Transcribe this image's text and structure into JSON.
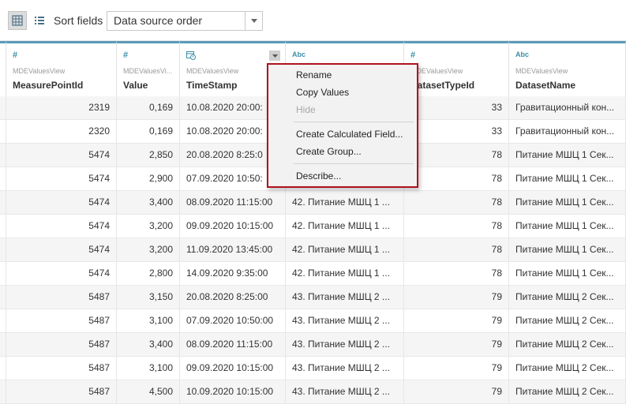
{
  "toolbar": {
    "sort_label": "Sort fields",
    "sort_value": "Data source order",
    "grid_icon": "grid-icon",
    "list_icon": "list-icon"
  },
  "columns": [
    {
      "type_icon": "#",
      "source": "",
      "name": ""
    },
    {
      "type_icon": "#",
      "source": "MDEValuesView",
      "name": "MeasurePointId"
    },
    {
      "type_icon": "#",
      "source": "MDEValuesVi...",
      "name": "Value"
    },
    {
      "type_icon": "calendar-clock",
      "source": "MDEValuesView",
      "name": "TimeStamp"
    },
    {
      "type_icon": "Abc",
      "source": "",
      "name": ""
    },
    {
      "type_icon": "#",
      "source": "MDEValuesView",
      "name": "DatasetTypeId"
    },
    {
      "type_icon": "Abc",
      "source": "MDEValuesView",
      "name": "DatasetName"
    }
  ],
  "rows": [
    {
      "mp": "2319",
      "val": "0,169",
      "ts": "10.08.2020 20:00:",
      "txt": "",
      "dt": "33",
      "dn": "Гравитационный кон..."
    },
    {
      "mp": "2320",
      "val": "0,169",
      "ts": "10.08.2020 20:00:",
      "txt": "",
      "dt": "33",
      "dn": "Гравитационный кон..."
    },
    {
      "mp": "5474",
      "val": "2,850",
      "ts": "20.08.2020 8:25:0",
      "txt": "",
      "dt": "78",
      "dn": "Питание МШЦ 1 Сек..."
    },
    {
      "mp": "5474",
      "val": "2,900",
      "ts": "07.09.2020 10:50:",
      "txt": "",
      "dt": "78",
      "dn": "Питание МШЦ 1 Сек..."
    },
    {
      "mp": "5474",
      "val": "3,400",
      "ts": "08.09.2020 11:15:00",
      "txt": "42. Питание МШЦ 1 ...",
      "dt": "78",
      "dn": "Питание МШЦ 1 Сек..."
    },
    {
      "mp": "5474",
      "val": "3,200",
      "ts": "09.09.2020 10:15:00",
      "txt": "42. Питание МШЦ 1 ...",
      "dt": "78",
      "dn": "Питание МШЦ 1 Сек..."
    },
    {
      "mp": "5474",
      "val": "3,200",
      "ts": "11.09.2020 13:45:00",
      "txt": "42. Питание МШЦ 1 ...",
      "dt": "78",
      "dn": "Питание МШЦ 1 Сек..."
    },
    {
      "mp": "5474",
      "val": "2,800",
      "ts": "14.09.2020 9:35:00",
      "txt": "42. Питание МШЦ 1 ...",
      "dt": "78",
      "dn": "Питание МШЦ 1 Сек..."
    },
    {
      "mp": "5487",
      "val": "3,150",
      "ts": "20.08.2020 8:25:00",
      "txt": "43. Питание МШЦ 2 ...",
      "dt": "79",
      "dn": "Питание МШЦ 2 Сек..."
    },
    {
      "mp": "5487",
      "val": "3,100",
      "ts": "07.09.2020 10:50:00",
      "txt": "43. Питание МШЦ 2 ...",
      "dt": "79",
      "dn": "Питание МШЦ 2 Сек..."
    },
    {
      "mp": "5487",
      "val": "3,400",
      "ts": "08.09.2020 11:15:00",
      "txt": "43. Питание МШЦ 2 ...",
      "dt": "79",
      "dn": "Питание МШЦ 2 Сек..."
    },
    {
      "mp": "5487",
      "val": "3,100",
      "ts": "09.09.2020 10:15:00",
      "txt": "43. Питание МШЦ 2 ...",
      "dt": "79",
      "dn": "Питание МШЦ 2 Сек..."
    },
    {
      "mp": "5487",
      "val": "4,500",
      "ts": "10.09.2020 10:15:00",
      "txt": "43. Питание МШЦ 2 ...",
      "dt": "79",
      "dn": "Питание МШЦ 2 Сек..."
    }
  ],
  "context_menu": {
    "items": [
      {
        "label": "Rename",
        "enabled": true
      },
      {
        "label": "Copy Values",
        "enabled": true
      },
      {
        "label": "Hide",
        "enabled": false
      },
      {
        "label": "Create Calculated Field...",
        "enabled": true
      },
      {
        "label": "Create Group...",
        "enabled": true
      },
      {
        "label": "Describe...",
        "enabled": true
      }
    ]
  },
  "colors": {
    "header_accent": "#5b9bb9",
    "menu_border": "#b0121b",
    "type_icon": "#3e8ea8"
  }
}
